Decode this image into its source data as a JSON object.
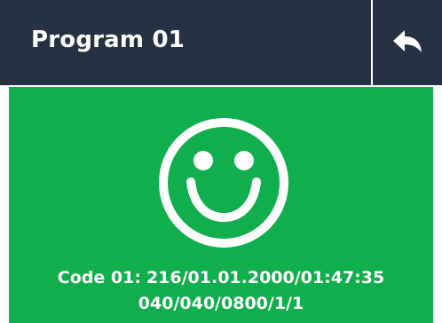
{
  "header": {
    "title": "Program 01",
    "back_icon": "undo-arrow-icon"
  },
  "status": {
    "state_icon": "smiley-face-icon",
    "code_label": "Code 01:",
    "code_value": "216/01.01.2000/01:47:35",
    "code_line2": "040/040/0800/1/1"
  },
  "colors": {
    "header_background": "#263243",
    "success_background": "#10ae4d",
    "foreground": "#ffffff"
  }
}
